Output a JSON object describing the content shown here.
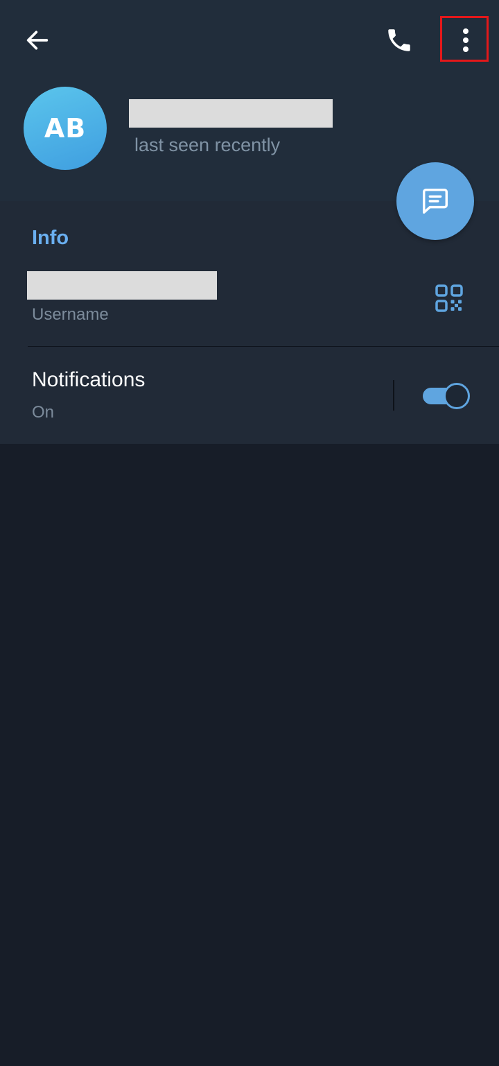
{
  "header": {
    "avatar_initials": "AB",
    "status": "last seen recently"
  },
  "info": {
    "section_title": "Info",
    "username_label": "Username"
  },
  "notifications": {
    "title": "Notifications",
    "value": "On",
    "enabled": true
  },
  "icons": {
    "back": "arrow-left-icon",
    "call": "phone-icon",
    "more": "more-vertical-icon",
    "message": "message-icon",
    "qr": "qr-code-icon"
  },
  "colors": {
    "accent": "#5fa5e0",
    "header_bg": "#212d3b",
    "section_bg": "#212a37",
    "page_bg": "#171d28",
    "highlight": "#e4181a"
  }
}
